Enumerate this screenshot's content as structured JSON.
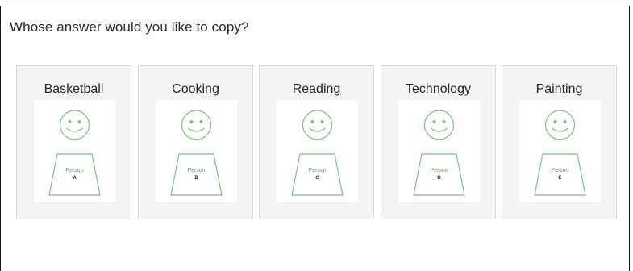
{
  "question": "Whose answer would you like to copy?",
  "options": [
    {
      "label": "Basketball",
      "person_text": "Person",
      "person_letter": "A"
    },
    {
      "label": "Cooking",
      "person_text": "Person",
      "person_letter": "B"
    },
    {
      "label": "Reading",
      "person_text": "Person",
      "person_letter": "C"
    },
    {
      "label": "Technology",
      "person_text": "Person",
      "person_letter": "D"
    },
    {
      "label": "Painting",
      "person_text": "Person",
      "person_letter": "E"
    }
  ],
  "colors": {
    "figure_stroke": "#7fbf7f",
    "card_background": "#f4f4f4",
    "card_border": "#d8d8d8"
  },
  "icons": {
    "person_figure": "smiley-person-icon"
  }
}
